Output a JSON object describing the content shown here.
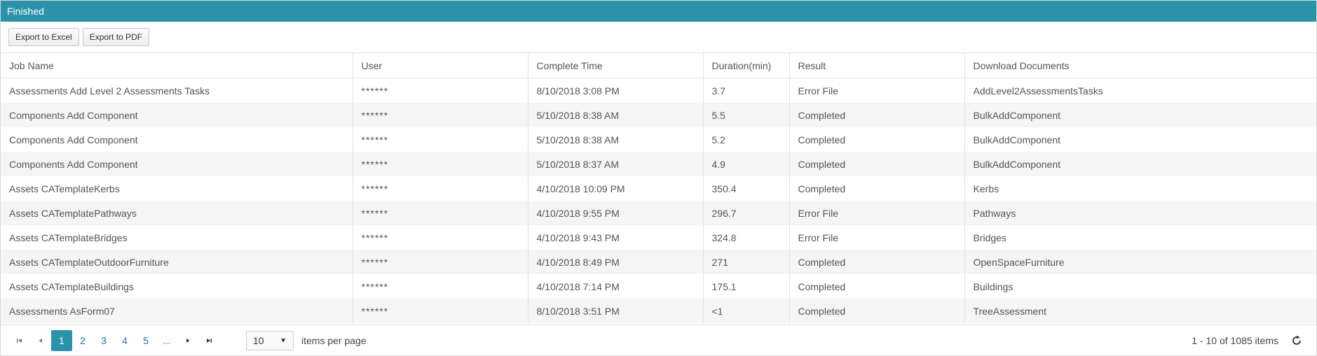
{
  "panel": {
    "title": "Finished"
  },
  "toolbar": {
    "export_excel": "Export to Excel",
    "export_pdf": "Export to PDF"
  },
  "columns": [
    "Job Name",
    "User",
    "Complete Time",
    "Duration(min)",
    "Result",
    "Download Documents"
  ],
  "rows": [
    {
      "job": "Assessments Add Level 2 Assessments Tasks",
      "user": "******",
      "time": "8/10/2018 3:08 PM",
      "duration": "3.7",
      "result": "Error File",
      "doc": "AddLevel2AssessmentsTasks"
    },
    {
      "job": "Components Add Component",
      "user": "******",
      "time": "5/10/2018 8:38 AM",
      "duration": "5.5",
      "result": "Completed",
      "doc": "BulkAddComponent"
    },
    {
      "job": "Components Add Component",
      "user": "******",
      "time": "5/10/2018 8:38 AM",
      "duration": "5.2",
      "result": "Completed",
      "doc": "BulkAddComponent"
    },
    {
      "job": "Components Add Component",
      "user": "******",
      "time": "5/10/2018 8:37 AM",
      "duration": "4.9",
      "result": "Completed",
      "doc": "BulkAddComponent"
    },
    {
      "job": "Assets CATemplateKerbs",
      "user": "******",
      "time": "4/10/2018 10:09 PM",
      "duration": "350.4",
      "result": "Completed",
      "doc": "Kerbs"
    },
    {
      "job": "Assets CATemplatePathways",
      "user": "******",
      "time": "4/10/2018 9:55 PM",
      "duration": "296.7",
      "result": "Error File",
      "doc": "Pathways"
    },
    {
      "job": "Assets CATemplateBridges",
      "user": "******",
      "time": "4/10/2018 9:43 PM",
      "duration": "324.8",
      "result": "Error File",
      "doc": "Bridges"
    },
    {
      "job": "Assets CATemplateOutdoorFurniture",
      "user": "******",
      "time": "4/10/2018 8:49 PM",
      "duration": "271",
      "result": "Completed",
      "doc": "OpenSpaceFurniture"
    },
    {
      "job": "Assets CATemplateBuildings",
      "user": "******",
      "time": "4/10/2018 7:14 PM",
      "duration": "175.1",
      "result": "Completed",
      "doc": "Buildings"
    },
    {
      "job": "Assessments AsForm07",
      "user": "******",
      "time": "8/10/2018 3:51 PM",
      "duration": "<1",
      "result": "Completed",
      "doc": "TreeAssessment"
    }
  ],
  "pager": {
    "pages": [
      "1",
      "2",
      "3",
      "4",
      "5",
      "..."
    ],
    "current": "1",
    "page_size": "10",
    "items_per_page_label": "items per page",
    "info": "1 - 10 of 1085 items"
  },
  "icons": {
    "first": "first-page-icon",
    "prev": "prev-page-icon",
    "next": "next-page-icon",
    "last": "last-page-icon",
    "refresh": "refresh-icon",
    "dropdown": "chevron-down-icon"
  },
  "colors": {
    "header": "#2b93a9",
    "link": "#2e6eb5",
    "muted": "#999999",
    "row_alt": "#f5f5f5"
  }
}
